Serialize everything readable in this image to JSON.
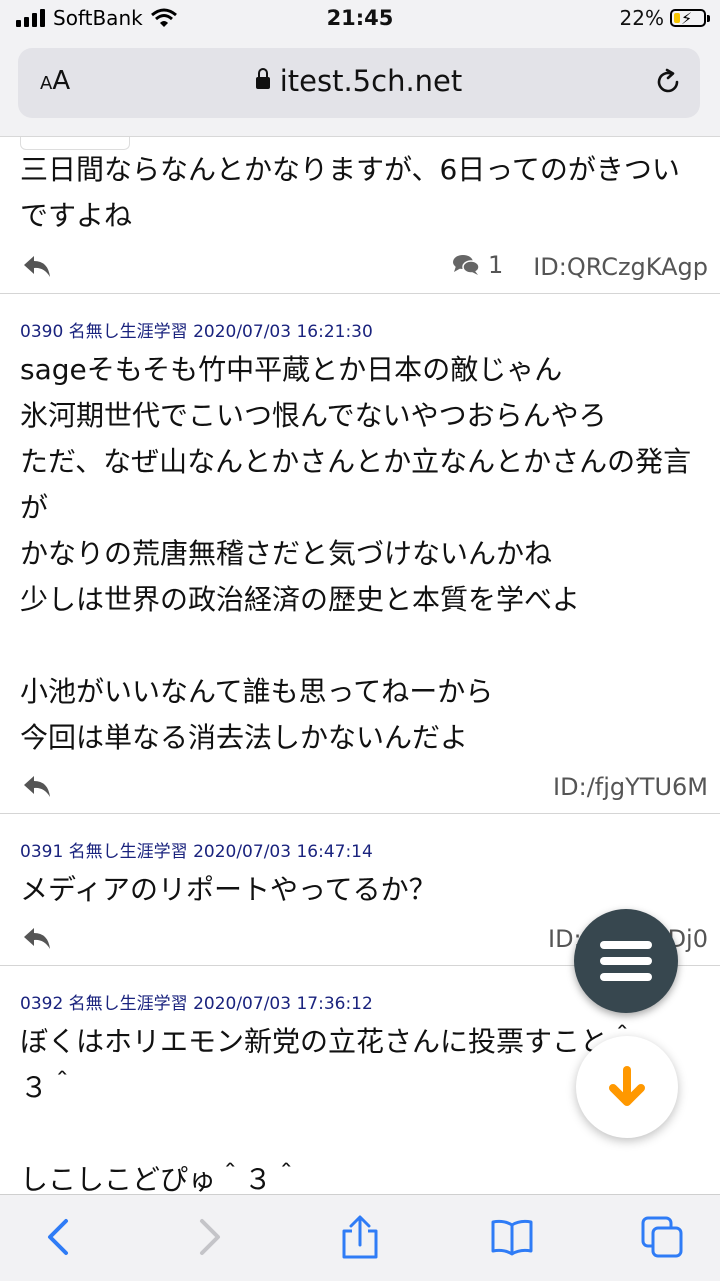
{
  "status_bar": {
    "carrier": "SoftBank",
    "time": "21:45",
    "battery_percent": "22%",
    "battery_level": 0.22,
    "icons": [
      "signal-icon",
      "wifi-icon",
      "battery-charging-icon"
    ]
  },
  "address_bar": {
    "text_size_label": "AA",
    "url": "itest.5ch.net",
    "icons": [
      "lock-icon",
      "reload-icon"
    ]
  },
  "posts": [
    {
      "body": "三日間ならなんとかなりますが、6日ってのがきついですよね",
      "reply_count": "1",
      "id": "ID:QRCzgKAgp"
    },
    {
      "meta": "0390 名無し生涯学習 2020/07/03 16:21:30",
      "body": "sageそもそも竹中平蔵とか日本の敵じゃん\n氷河期世代でこいつ恨んでないやつおらんやろ\nただ、なぜ山なんとかさんとか立なんとかさんの発言が\nかなりの荒唐無稽さだと気づけないんかね\n少しは世界の政治経済の歴史と本質を学べよ\n\n小池がいいなんて誰も思ってねーから\n今回は単なる消去法しかないんだよ",
      "id": "ID:/fjgYTU6M"
    },
    {
      "meta": "0391 名無し生涯学習 2020/07/03 16:47:14",
      "body": "メディアのリポートやってるか？",
      "id": "ID:",
      "id_tail": "Dj0"
    },
    {
      "meta": "0392 名無し生涯学習 2020/07/03 17:36:12",
      "body": "ぼくはホリエモン新党の立花さんに投票すこと＾\n３＾\n\nしこしこどぴゅ＾３＾"
    }
  ],
  "fabs": {
    "menu": "menu-icon",
    "scroll_down": "arrow-down-icon"
  },
  "colors": {
    "meta_text": "#1a237e",
    "fab_menu": "#37474f",
    "fab_arrow": "#ff9800",
    "toolbar_icon": "#2f7cf6"
  },
  "toolbar": {
    "icons": [
      "back-icon",
      "forward-icon",
      "share-icon",
      "bookmarks-icon",
      "tabs-icon"
    ]
  }
}
